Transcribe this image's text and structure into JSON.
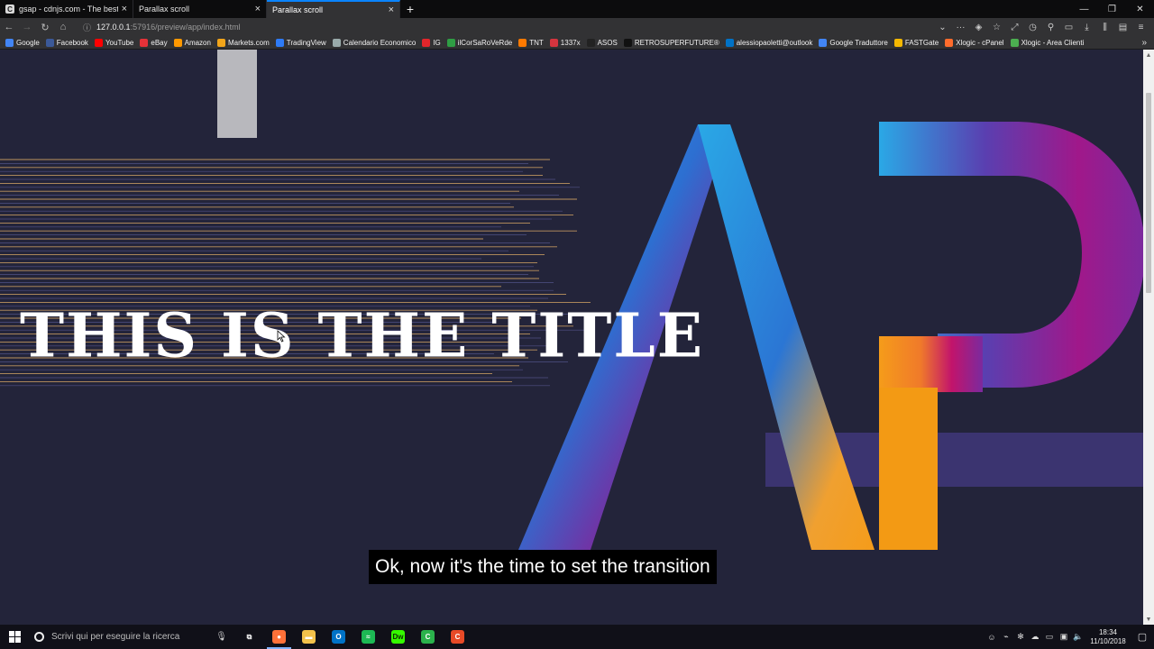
{
  "browser": {
    "tabs": [
      {
        "label": "gsap - cdnjs.com - The best FO",
        "favicon": "C",
        "active": false
      },
      {
        "label": "Parallax scroll",
        "favicon": "",
        "active": false
      },
      {
        "label": "Parallax scroll",
        "favicon": "",
        "active": true
      }
    ],
    "url": {
      "host": "127.0.0.1",
      "path": ":57916/preview/app/index.html"
    },
    "bookmarks": [
      {
        "label": "Google",
        "color": "#4285f4"
      },
      {
        "label": "Facebook",
        "color": "#3b5998"
      },
      {
        "label": "YouTube",
        "color": "#ff0000"
      },
      {
        "label": "eBay",
        "color": "#e53238"
      },
      {
        "label": "Amazon",
        "color": "#ff9900"
      },
      {
        "label": "Markets.com",
        "color": "#f2a51a"
      },
      {
        "label": "TradingView",
        "color": "#2e7bf6"
      },
      {
        "label": "Calendario Economico",
        "color": "#9aa"
      },
      {
        "label": "IG",
        "color": "#e3262b"
      },
      {
        "label": "ilCorSaRoVeRde",
        "color": "#2f9e44"
      },
      {
        "label": "TNT",
        "color": "#ff7a00"
      },
      {
        "label": "1337x",
        "color": "#d4353e"
      },
      {
        "label": "ASOS",
        "color": "#222222"
      },
      {
        "label": "RETROSUPERFUTURE®",
        "color": "#111111"
      },
      {
        "label": "alessiopaoletti@outlook",
        "color": "#0072c6"
      },
      {
        "label": "Google Traduttore",
        "color": "#4285f4"
      },
      {
        "label": "FASTGate",
        "color": "#f5b800"
      },
      {
        "label": "Xlogic - cPanel",
        "color": "#ff6c2c"
      },
      {
        "label": "Xlogic - Area Clienti",
        "color": "#4caf50"
      }
    ]
  },
  "page": {
    "title": "THIS IS THE TITLE",
    "subtitle": "Ok, now it's the time to set the transition"
  },
  "taskbar": {
    "search_placeholder": "Scrivi qui per eseguire la ricerca",
    "time": "18:34",
    "date": "11/10/2018",
    "apps": [
      {
        "name": "task-view",
        "color": "#101018",
        "glyph": "⧉"
      },
      {
        "name": "firefox",
        "color": "#ff7139",
        "glyph": "●"
      },
      {
        "name": "file-explorer",
        "color": "#f3c24b",
        "glyph": "▬"
      },
      {
        "name": "outlook",
        "color": "#0072c6",
        "glyph": "O"
      },
      {
        "name": "spotify",
        "color": "#1db954",
        "glyph": "≈"
      },
      {
        "name": "dreamweaver",
        "color": "#35fa00",
        "glyph": "Dw"
      },
      {
        "name": "camtasia",
        "color": "#2bb24c",
        "glyph": "C"
      },
      {
        "name": "camtasia-recorder",
        "color": "#e84a27",
        "glyph": "C"
      }
    ]
  },
  "colors": {
    "page_bg": "#23243a",
    "accent_blue": "#29a7e8",
    "accent_purple": "#7b2a9e",
    "accent_magenta": "#c2146b",
    "accent_orange": "#f59c1a"
  }
}
